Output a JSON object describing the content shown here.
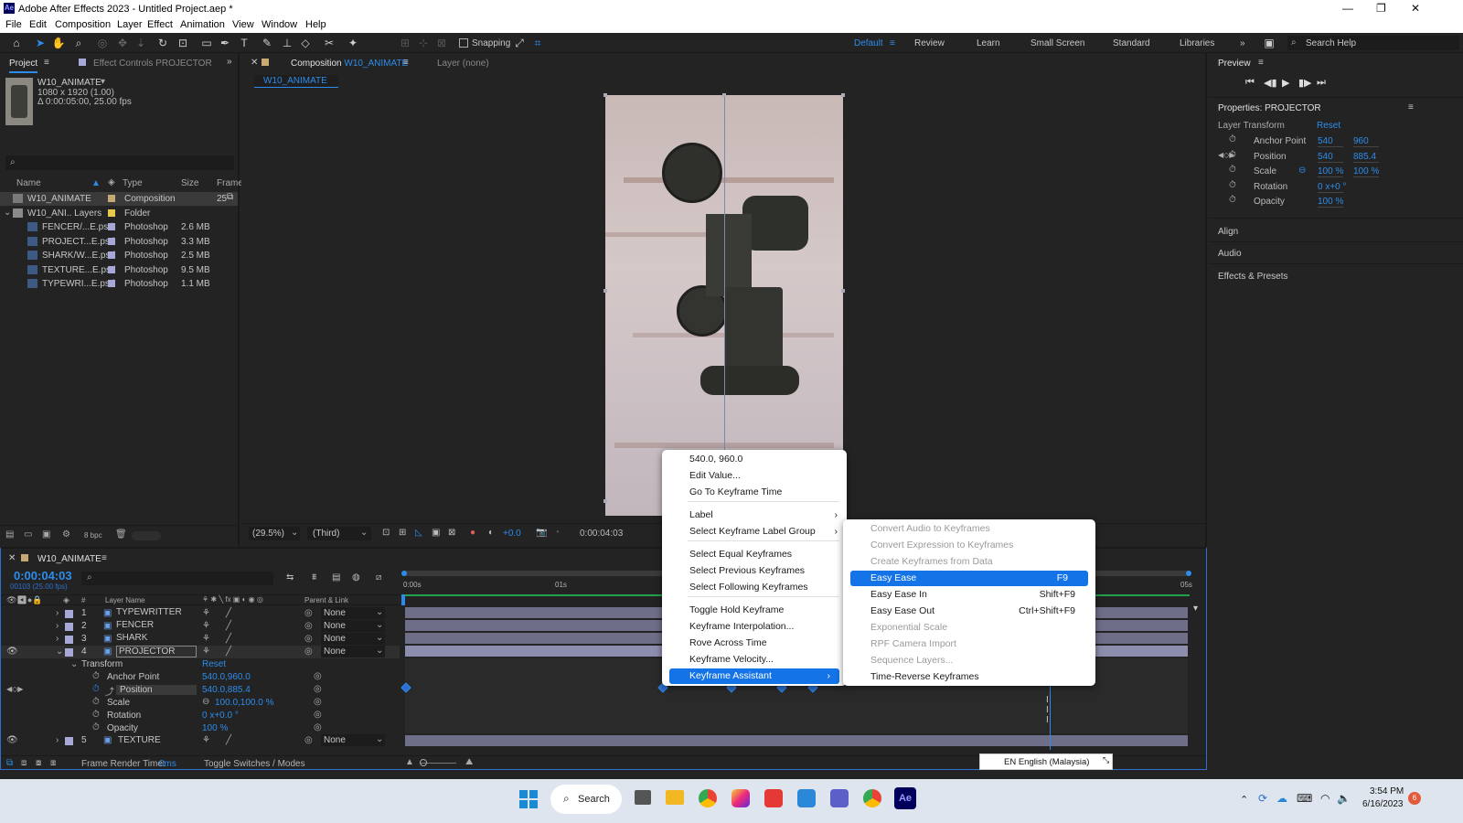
{
  "window": {
    "title": "Adobe After Effects 2023 - Untitled Project.aep *",
    "logo": "Ae"
  },
  "menubar": [
    "File",
    "Edit",
    "Composition",
    "Layer",
    "Effect",
    "Animation",
    "View",
    "Window",
    "Help"
  ],
  "toolbar": {
    "snapping_label": "Snapping",
    "workspaces": [
      "Default",
      "Review",
      "Learn",
      "Small Screen",
      "Standard",
      "Libraries"
    ],
    "search_placeholder": "Search Help"
  },
  "project_panel": {
    "tab": "Project",
    "effect_controls_tab": "Effect Controls PROJECTOR",
    "comp_name": "W10_ANIMATE",
    "comp_info1": "1080 x 1920 (1.00)",
    "comp_info2": "Δ 0:00:05:00, 25.00 fps",
    "search_placeholder": "",
    "columns": [
      "Name",
      "Type",
      "Size",
      "Frame R"
    ],
    "items": [
      {
        "name": "W10_ANIMATE",
        "type": "Composition",
        "size": "",
        "frame": "25",
        "color": "#c8a873"
      },
      {
        "name": "W10_ANI.. Layers",
        "type": "Folder",
        "size": "",
        "frame": "",
        "color": "#e6c84a"
      },
      {
        "name": "FENCER/...E.psd",
        "type": "Photoshop",
        "size": "2.6 MB",
        "frame": "",
        "color": "#a8a8d8"
      },
      {
        "name": "PROJECT...E.psd",
        "type": "Photoshop",
        "size": "3.3 MB",
        "frame": "",
        "color": "#a8a8d8"
      },
      {
        "name": "SHARK/W...E.psd",
        "type": "Photoshop",
        "size": "2.5 MB",
        "frame": "",
        "color": "#a8a8d8"
      },
      {
        "name": "TEXTURE...E.psd",
        "type": "Photoshop",
        "size": "9.5 MB",
        "frame": "",
        "color": "#a8a8d8"
      },
      {
        "name": "TYPEWRI...E.psd",
        "type": "Photoshop",
        "size": "1.1 MB",
        "frame": "",
        "color": "#a8a8d8"
      }
    ],
    "bpc": "8 bpc"
  },
  "comp_panel": {
    "tab_prefix": "Composition",
    "tab_name": "W10_ANIMATE",
    "layer_tab": "Layer (none)",
    "breadcrumb": "W10_ANIMATE",
    "zoom": "(29.5%)",
    "resolution": "(Third)",
    "exposure": "+0.0",
    "timecode": "0:00:04:03"
  },
  "right_panel": {
    "preview_tab": "Preview",
    "properties_title": "Properties: PROJECTOR",
    "layer_transform": "Layer Transform",
    "reset": "Reset",
    "props": [
      {
        "name": "Anchor Point",
        "v1": "540",
        "v2": "960"
      },
      {
        "name": "Position",
        "v1": "540",
        "v2": "885.4"
      },
      {
        "name": "Scale",
        "v1": "100 %",
        "v2": "100 %"
      },
      {
        "name": "Rotation",
        "v1": "0 x+0 °",
        "v2": ""
      },
      {
        "name": "Opacity",
        "v1": "100 %",
        "v2": ""
      }
    ],
    "sections": [
      "Align",
      "Audio",
      "Effects & Presets"
    ]
  },
  "timeline": {
    "tab": "W10_ANIMATE",
    "timecode": "0:00:04:03",
    "frame_info": "00103 (25.00 fps)",
    "headers": {
      "num": "#",
      "layer": "Layer Name",
      "parent": "Parent & Link"
    },
    "ruler": [
      "0:00s",
      "01s",
      "05s"
    ],
    "layers": [
      {
        "num": "1",
        "name": "TYPEWRITTER",
        "parent": "None"
      },
      {
        "num": "2",
        "name": "FENCER",
        "parent": "None"
      },
      {
        "num": "3",
        "name": "SHARK",
        "parent": "None"
      },
      {
        "num": "4",
        "name": "PROJECTOR",
        "parent": "None"
      }
    ],
    "layer5": {
      "num": "5",
      "name": "TEXTURE",
      "parent": "None"
    },
    "transform": {
      "label": "Transform",
      "reset": "Reset"
    },
    "props": [
      {
        "name": "Anchor Point",
        "value": "540.0,960.0"
      },
      {
        "name": "Position",
        "value": "540.0,885.4"
      },
      {
        "name": "Scale",
        "value": "100.0,100.0 %"
      },
      {
        "name": "Rotation",
        "value": "0 x+0.0 °"
      },
      {
        "name": "Opacity",
        "value": "100 %"
      }
    ],
    "footer": {
      "render_label": "Frame Render Time:",
      "render_value": "0ms",
      "toggle": "Toggle Switches / Modes"
    }
  },
  "context_menu": {
    "items": [
      {
        "label": "540.0, 960.0"
      },
      {
        "label": "Edit Value..."
      },
      {
        "label": "Go To Keyframe Time"
      },
      {
        "label": "Label",
        "arrow": "›"
      },
      {
        "label": "Select Keyframe Label Group",
        "arrow": "›"
      },
      {
        "label": "Select Equal Keyframes"
      },
      {
        "label": "Select Previous Keyframes"
      },
      {
        "label": "Select Following Keyframes"
      },
      {
        "label": "Toggle Hold Keyframe"
      },
      {
        "label": "Keyframe Interpolation..."
      },
      {
        "label": "Rove Across Time"
      },
      {
        "label": "Keyframe Velocity..."
      },
      {
        "label": "Keyframe Assistant",
        "arrow": "›"
      }
    ]
  },
  "submenu": {
    "items": [
      {
        "label": "Convert Audio to Keyframes",
        "shortcut": ""
      },
      {
        "label": "Convert Expression to Keyframes",
        "shortcut": ""
      },
      {
        "label": "Create Keyframes from Data",
        "shortcut": ""
      },
      {
        "label": "Easy Ease",
        "shortcut": "F9"
      },
      {
        "label": "Easy Ease In",
        "shortcut": "Shift+F9"
      },
      {
        "label": "Easy Ease Out",
        "shortcut": "Ctrl+Shift+F9"
      },
      {
        "label": "Exponential Scale",
        "shortcut": ""
      },
      {
        "label": "RPF Camera Import",
        "shortcut": ""
      },
      {
        "label": "Sequence Layers...",
        "shortcut": ""
      },
      {
        "label": "Time-Reverse Keyframes",
        "shortcut": ""
      }
    ]
  },
  "language_tooltip": "EN English (Malaysia)",
  "taskbar": {
    "search": "Search",
    "time": "3:54 PM",
    "date": "6/16/2023",
    "badge": "6"
  }
}
